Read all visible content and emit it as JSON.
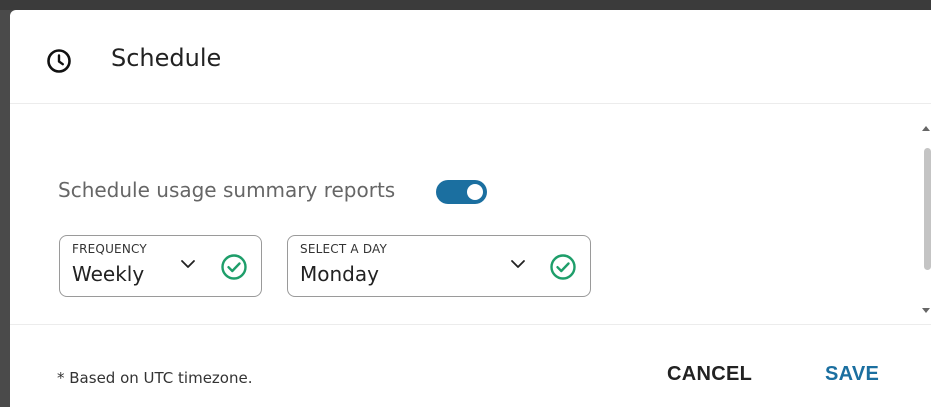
{
  "dialog": {
    "title": "Schedule",
    "icon": "clock-icon"
  },
  "schedule_toggle": {
    "label": "Schedule usage summary reports",
    "enabled": true,
    "accent_color": "#1b6fa0"
  },
  "frequency": {
    "label": "FREQUENCY",
    "value": "Weekly"
  },
  "day": {
    "label": "SELECT A DAY",
    "value": "Monday"
  },
  "footer": {
    "note": "* Based on UTC timezone.",
    "cancel_label": "CANCEL",
    "save_label": "SAVE"
  },
  "colors": {
    "check_green": "#1e9e6a",
    "save_blue": "#1b6fa0"
  }
}
